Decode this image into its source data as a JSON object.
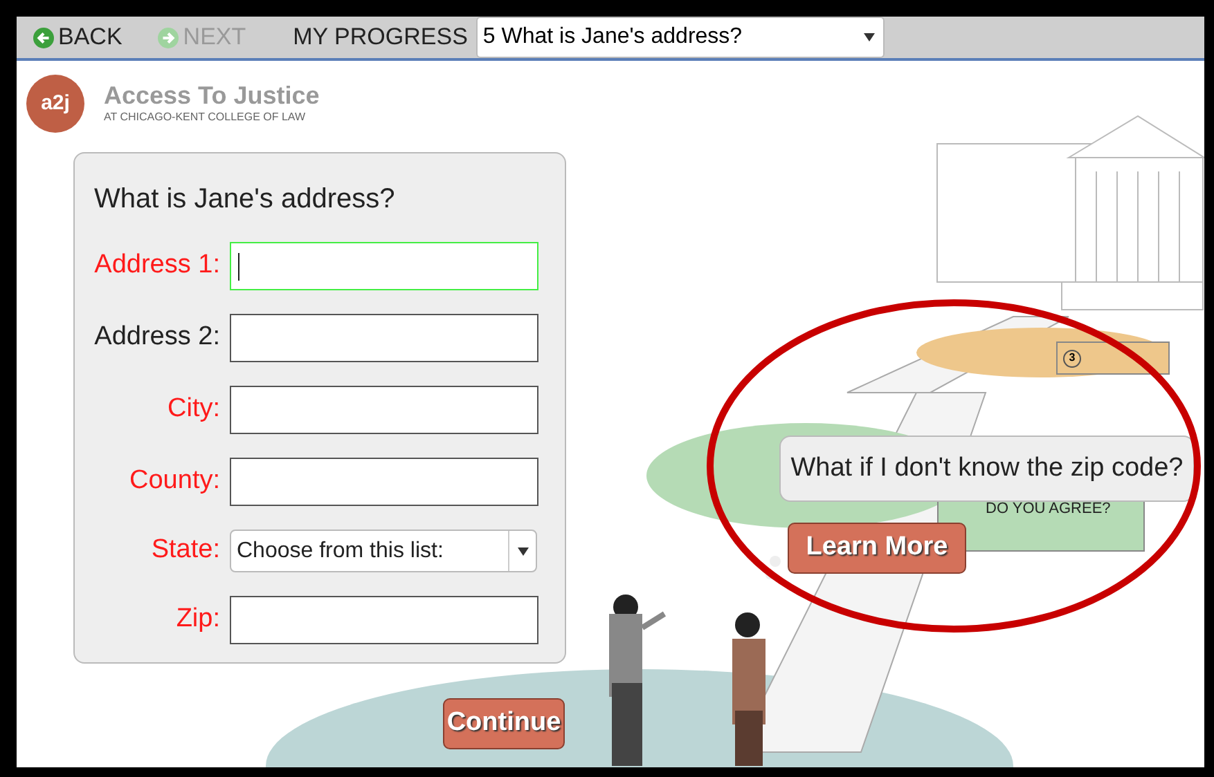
{
  "nav": {
    "back": {
      "label": "BACK",
      "disabled": false
    },
    "next": {
      "label": "NEXT",
      "disabled": true
    },
    "progress_label": "MY PROGRESS",
    "progress_value": "5 What is Jane's address?"
  },
  "brand": {
    "logo": "a2j",
    "title": "Access To Justice",
    "subtitle": "AT CHICAGO-KENT COLLEGE OF LAW"
  },
  "form": {
    "question": "What is Jane's address?",
    "fields": [
      {
        "kind": "text",
        "label": "Address 1:",
        "required": true,
        "focused": true
      },
      {
        "kind": "text",
        "label": "Address 2:",
        "required": false,
        "focused": false
      },
      {
        "kind": "text",
        "label": "City:",
        "required": true,
        "focused": false
      },
      {
        "kind": "text",
        "label": "County:",
        "required": true,
        "focused": false
      },
      {
        "kind": "select",
        "label": "State:",
        "required": true,
        "focused": false,
        "value": "Choose from this list:"
      },
      {
        "kind": "text",
        "label": "Zip:",
        "required": true,
        "focused": false
      }
    ],
    "continue": "Continue"
  },
  "scene": {
    "signs": [
      {
        "number": "3"
      },
      {
        "text": "DO YOU AGREE?"
      }
    ]
  },
  "help": {
    "question": "What if I don't know the zip code?",
    "button": "Learn More"
  }
}
